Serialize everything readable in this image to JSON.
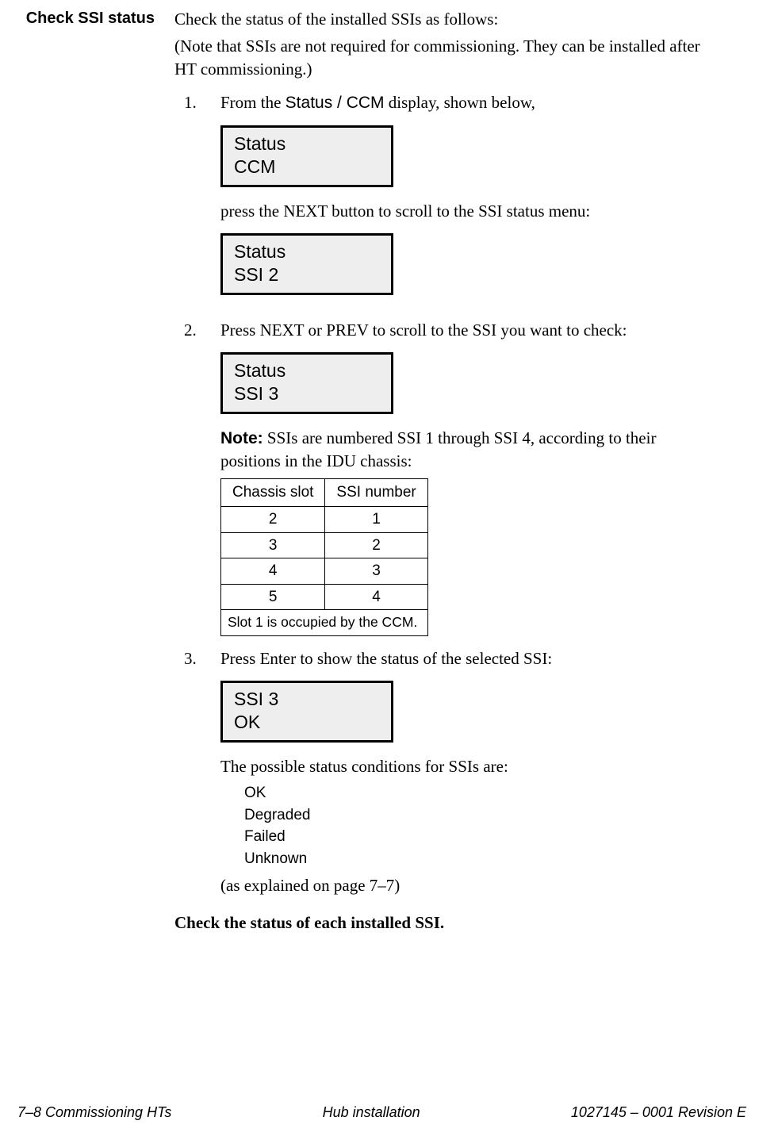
{
  "heading": "Check SSI status",
  "intro": {
    "p1": "Check the status of the installed SSIs as follows:",
    "p2": "(Note that SSIs are not required for commissioning. They can be installed after HT commissioning.)"
  },
  "steps": {
    "s1": {
      "lead_before": "From the ",
      "lead_sans": "Status / CCM",
      "lead_after": " display, shown below,",
      "lcd_l1": "Status",
      "lcd_l2": "CCM",
      "follow": "press the NEXT button to scroll to the SSI status menu:",
      "lcd2_l1": "Status",
      "lcd2_l2": "SSI 2"
    },
    "s2": {
      "text": "Press NEXT or PREV to scroll to the SSI you want to check:",
      "lcd_l1": "Status",
      "lcd_l2": "SSI 3",
      "note_label": "Note:",
      "note_text": " SSIs are numbered SSI 1 through SSI 4, according to their positions in the IDU chassis:"
    },
    "s3": {
      "text": "Press Enter to show the status of the selected SSI:",
      "lcd_l1": "SSI 3",
      "lcd_l2": "OK",
      "after": "The possible status conditions for SSIs are:",
      "statuses": [
        "OK",
        "Degraded",
        "Failed",
        "Unknown"
      ],
      "after2": "(as explained on page 7–7)"
    }
  },
  "chart_data": {
    "type": "table",
    "headers": [
      "Chassis slot",
      "SSI number"
    ],
    "rows": [
      [
        "2",
        "1"
      ],
      [
        "3",
        "2"
      ],
      [
        "4",
        "3"
      ],
      [
        "5",
        "4"
      ]
    ],
    "footnote": "Slot 1 is occupied by the CCM."
  },
  "final": "Check the status of each installed SSI.",
  "footer": {
    "left": "7–8  Commissioning HTs",
    "center": "Hub installation",
    "right": "1027145 – 0001   Revision E"
  }
}
